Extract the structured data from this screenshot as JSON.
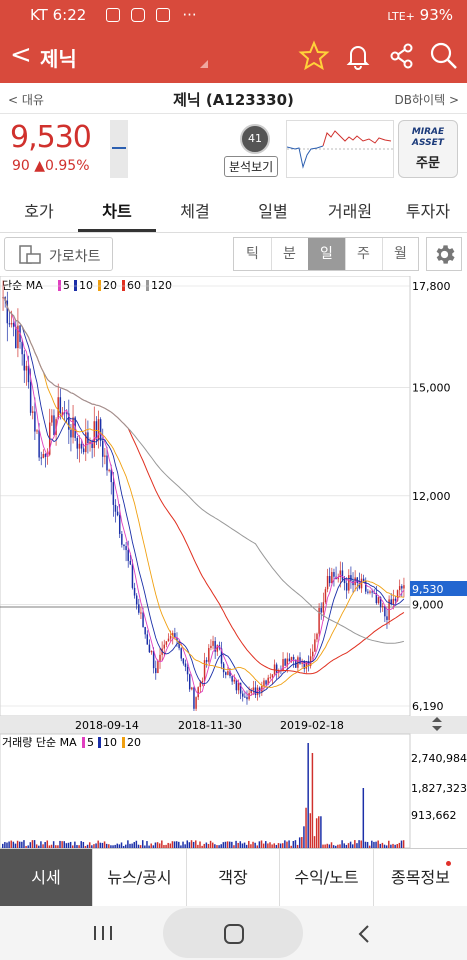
{
  "status": {
    "carrier_time": "KT 6:22",
    "battery": "93%",
    "network": "LTE+"
  },
  "appbar": {
    "back": "<",
    "title": "제닉"
  },
  "stocknav": {
    "prev": "< 대유",
    "stock": "제닉 (A123330)",
    "next": "DB하이텍 >"
  },
  "quote": {
    "price": "9,530",
    "change": "90 ▲0.95%",
    "score": "41",
    "analysis_label": "분석보기",
    "broker_line1": "MIRAE",
    "broker_line2": "ASSET",
    "broker_btn": "주문"
  },
  "tabs": [
    "호가",
    "차트",
    "체결",
    "일별",
    "거래원",
    "투자자"
  ],
  "toolbar": {
    "landscape": "가로차트",
    "periods": [
      "틱",
      "분",
      "일",
      "주",
      "월"
    ],
    "selected": "일"
  },
  "chart_labels": {
    "ma_prefix": "단순 MA",
    "ma_periods": [
      "5",
      "10",
      "20",
      "60",
      "120"
    ],
    "vol_prefix": "거래량 단순 MA",
    "vol_periods": [
      "5",
      "10",
      "20"
    ],
    "price_ticks": [
      "17,800",
      "15,000",
      "12,000",
      "9,000",
      "6,190"
    ],
    "current_tag": "9,530",
    "dates": [
      "2018-09-14",
      "2018-11-30",
      "2019-02-18"
    ],
    "vol_ticks": [
      "2,740,984",
      "1,827,323",
      "913,662"
    ]
  },
  "colors": {
    "up": "#d0312d",
    "down": "#1b2fa8",
    "ma5": "#e040c0",
    "ma10": "#1b2fa8",
    "ma20": "#f0a010",
    "ma60": "#e03020",
    "ma120": "#999999",
    "accent": "#d84a3c"
  },
  "chart_data": {
    "type": "line",
    "series": [
      {
        "x": [
          "2018-08-15",
          "2018-08-25",
          "2018-09-05",
          "2018-09-14",
          "2018-09-25",
          "2018-10-05",
          "2018-10-15",
          "2018-10-25",
          "2018-11-05",
          "2018-11-15",
          "2018-11-30",
          "2018-12-10",
          "2018-12-20",
          "2019-01-05",
          "2019-01-15",
          "2019-01-25",
          "2019-02-05",
          "2019-02-18",
          "2019-02-28",
          "2019-03-10",
          "2019-03-20",
          "2019-03-31"
        ],
        "values": [
          17500,
          16000,
          13000,
          14500,
          13400,
          13800,
          11500,
          9000,
          7200,
          8300,
          6300,
          8000,
          6800,
          6500,
          7100,
          7600,
          7200,
          9900,
          9600,
          9400,
          8700,
          9530
        ]
      }
    ],
    "ylim": [
      6190,
      17800
    ]
  },
  "bottomnav": [
    "시세",
    "뉴스/공시",
    "객장",
    "수익/노트",
    "종목정보"
  ]
}
